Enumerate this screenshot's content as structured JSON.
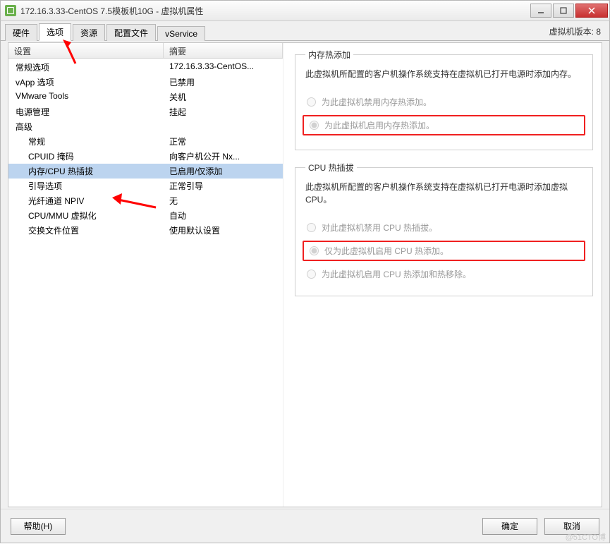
{
  "titlebar": {
    "title": "172.16.3.33-CentOS 7.5模板机10G - 虚拟机属性"
  },
  "tabs": {
    "items": [
      "硬件",
      "选项",
      "资源",
      "配置文件",
      "vService"
    ],
    "active": 1,
    "version_label": "虚拟机版本: 8"
  },
  "columns": {
    "setting": "设置",
    "summary": "摘要"
  },
  "rows": [
    {
      "label": "常规选项",
      "summary": "172.16.3.33-CentOS...",
      "indent": 0
    },
    {
      "label": "vApp 选项",
      "summary": "已禁用",
      "indent": 0
    },
    {
      "label": "VMware Tools",
      "summary": "关机",
      "indent": 0
    },
    {
      "label": "电源管理",
      "summary": "挂起",
      "indent": 0
    },
    {
      "label": "高级",
      "summary": "",
      "indent": 0
    },
    {
      "label": "常规",
      "summary": "正常",
      "indent": 1
    },
    {
      "label": "CPUID 掩码",
      "summary": "向客户机公开 Nx...",
      "indent": 1
    },
    {
      "label": "内存/CPU 热插拔",
      "summary": "已启用/仅添加",
      "indent": 1,
      "selected": true
    },
    {
      "label": "引导选项",
      "summary": "正常引导",
      "indent": 1
    },
    {
      "label": "光纤通道 NPIV",
      "summary": "无",
      "indent": 1
    },
    {
      "label": "CPU/MMU 虚拟化",
      "summary": "自动",
      "indent": 1
    },
    {
      "label": "交换文件位置",
      "summary": "使用默认设置",
      "indent": 1
    }
  ],
  "memory": {
    "legend": "内存热添加",
    "desc": "此虚拟机所配置的客户机操作系统支持在虚拟机已打开电源时添加内存。",
    "opt_disable": "为此虚拟机禁用内存热添加。",
    "opt_enable": "为此虚拟机启用内存热添加。"
  },
  "cpu": {
    "legend": "CPU 热插拔",
    "desc": "此虚拟机所配置的客户机操作系统支持在虚拟机已打开电源时添加虚拟 CPU。",
    "opt_disable": "对此虚拟机禁用 CPU 热插拔。",
    "opt_add": "仅为此虚拟机启用 CPU 热添加。",
    "opt_addremove": "为此虚拟机启用 CPU 热添加和热移除。"
  },
  "footer": {
    "help": "帮助(H)",
    "ok": "确定",
    "cancel": "取消"
  },
  "watermark": "@51CTO博"
}
